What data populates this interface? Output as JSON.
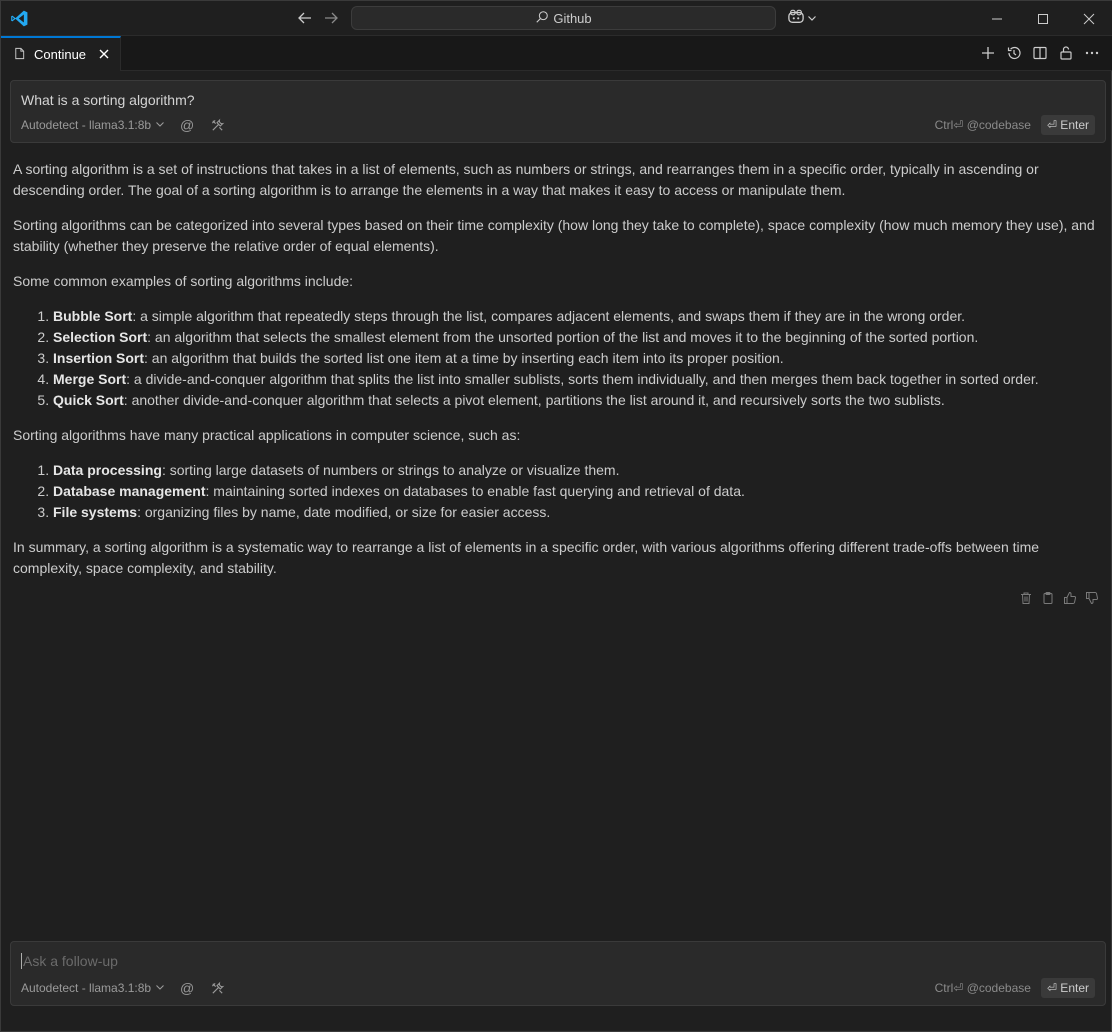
{
  "titlebar": {
    "search_text": "Github"
  },
  "tab": {
    "label": "Continue"
  },
  "input_top": {
    "value": "What is a sorting algorithm?",
    "model": "Autodetect - llama3.1:8b",
    "shortcut": "Ctrl⏎ @codebase",
    "enter_label": "⏎ Enter"
  },
  "input_bottom": {
    "placeholder": "Ask a follow-up",
    "model": "Autodetect - llama3.1:8b",
    "shortcut": "Ctrl⏎ @codebase",
    "enter_label": "⏎ Enter"
  },
  "response": {
    "p1": "A sorting algorithm is a set of instructions that takes in a list of elements, such as numbers or strings, and rearranges them in a specific order, typically in ascending or descending order. The goal of a sorting algorithm is to arrange the elements in a way that makes it easy to access or manipulate them.",
    "p2": "Sorting algorithms can be categorized into several types based on their time complexity (how long they take to complete), space complexity (how much memory they use), and stability (whether they preserve the relative order of equal elements).",
    "p3": "Some common examples of sorting algorithms include:",
    "list1": [
      {
        "term": "Bubble Sort",
        "desc": ": a simple algorithm that repeatedly steps through the list, compares adjacent elements, and swaps them if they are in the wrong order."
      },
      {
        "term": "Selection Sort",
        "desc": ": an algorithm that selects the smallest element from the unsorted portion of the list and moves it to the beginning of the sorted portion."
      },
      {
        "term": "Insertion Sort",
        "desc": ": an algorithm that builds the sorted list one item at a time by inserting each item into its proper position."
      },
      {
        "term": "Merge Sort",
        "desc": ": a divide-and-conquer algorithm that splits the list into smaller sublists, sorts them individually, and then merges them back together in sorted order."
      },
      {
        "term": "Quick Sort",
        "desc": ": another divide-and-conquer algorithm that selects a pivot element, partitions the list around it, and recursively sorts the two sublists."
      }
    ],
    "p4": "Sorting algorithms have many practical applications in computer science, such as:",
    "list2": [
      {
        "term": "Data processing",
        "desc": ": sorting large datasets of numbers or strings to analyze or visualize them."
      },
      {
        "term": "Database management",
        "desc": ": maintaining sorted indexes on databases to enable fast querying and retrieval of data."
      },
      {
        "term": "File systems",
        "desc": ": organizing files by name, date modified, or size for easier access."
      }
    ],
    "p5": "In summary, a sorting algorithm is a systematic way to rearrange a list of elements in a specific order, with various algorithms offering different trade-offs between time complexity, space complexity, and stability."
  },
  "colors": {
    "accent": "#0078d4",
    "background": "#1f1f1f",
    "input_background": "#2a2a2a"
  }
}
